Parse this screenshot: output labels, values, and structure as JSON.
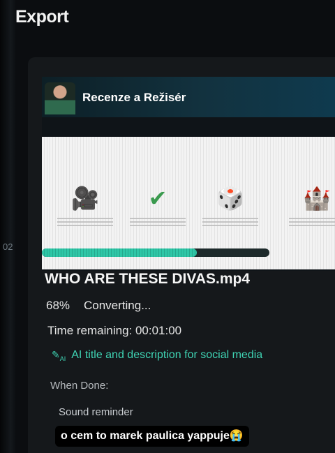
{
  "app": {
    "title": "Export"
  },
  "bezel": {
    "side_number": "02"
  },
  "preview": {
    "channel_title": "Recenze a Režisér",
    "slide_icons": [
      {
        "icon": "video-camera-icon",
        "symbol": "🎥",
        "color": "#e8742a"
      },
      {
        "icon": "checkmark-icon",
        "symbol": "✔",
        "color": "#3a9a4e"
      },
      {
        "icon": "dice-icon",
        "symbol": "🎲",
        "color": "#3a7fc6"
      },
      {
        "icon": "castle-icon",
        "symbol": "🏰",
        "color": "#c0398f"
      }
    ],
    "progress_fraction": 0.68
  },
  "export": {
    "file_name": "WHO ARE THESE DIVAS.mp4",
    "percent_label": "68%",
    "status": "Converting...",
    "time_remaining": "Time remaining: 00:01:00"
  },
  "ai_feature": {
    "icon_label": "AI",
    "label": "AI title and description for social media",
    "accent": "#3fd4b4"
  },
  "when_done": {
    "label": "When Done:",
    "option": "Sound reminder"
  },
  "overlay_caption": "o cem to marek paulica yappuje😭"
}
